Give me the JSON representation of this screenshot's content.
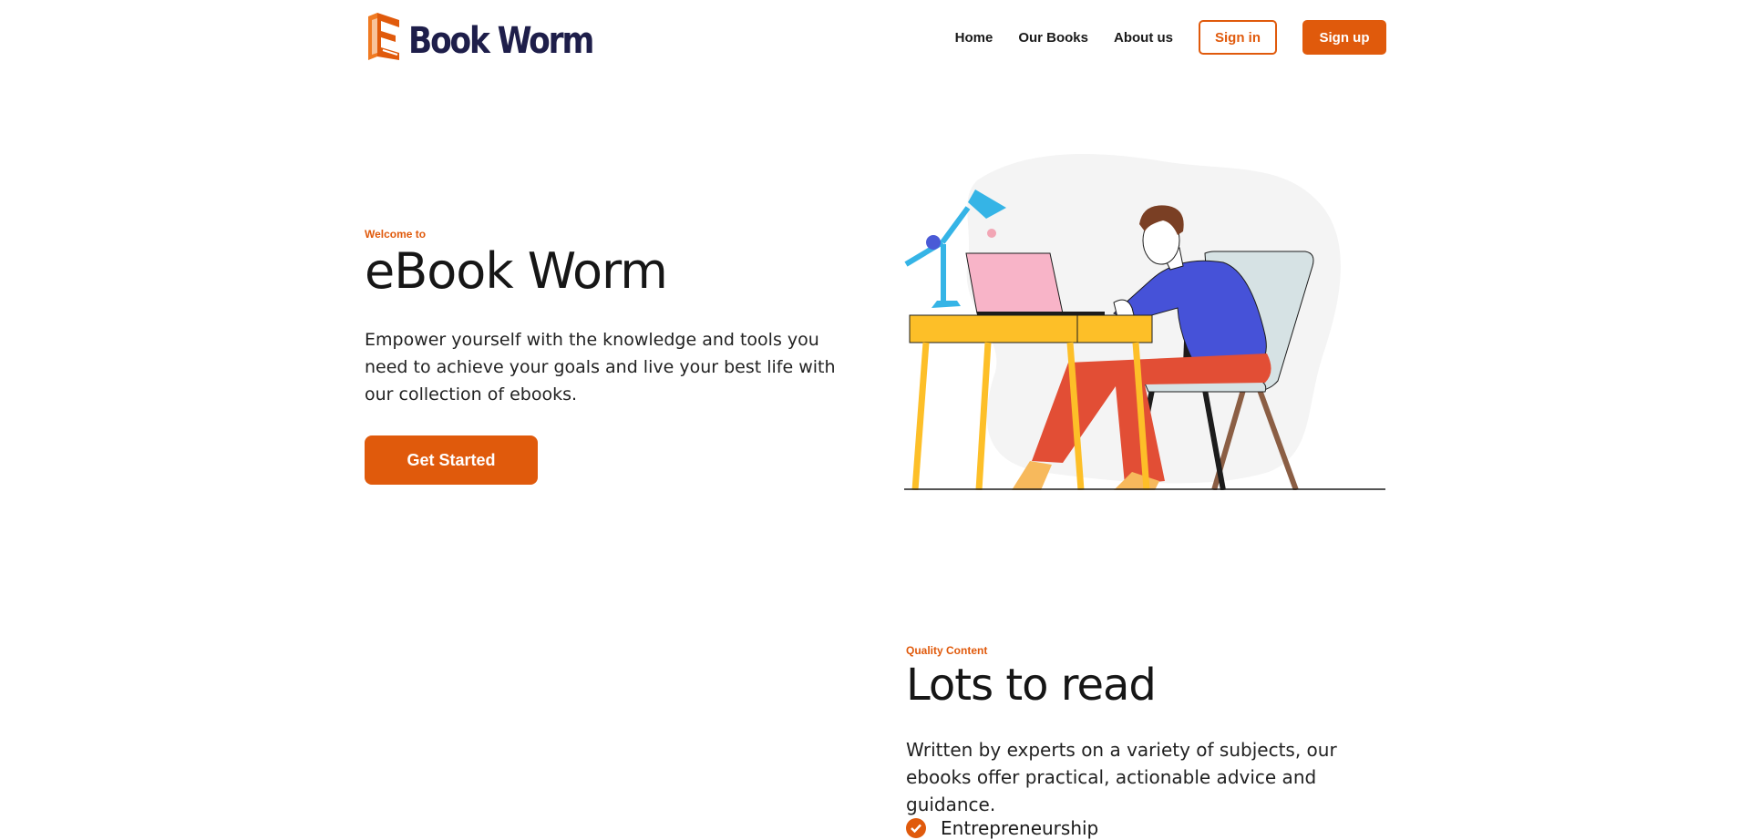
{
  "header": {
    "logo_text": "Book Worm",
    "nav": [
      "Home",
      "Our Books",
      "About us"
    ],
    "sign_in": "Sign in",
    "sign_up": "Sign up"
  },
  "hero": {
    "eyebrow": "Welcome to",
    "title": "eBook Worm",
    "description": "Empower yourself with the knowledge and tools you need to achieve your goals and live your best life with our collection of ebooks.",
    "cta": "Get Started"
  },
  "features": {
    "eyebrow": "Quality Content",
    "title": "Lots to read",
    "description": "Written by experts on a variety of subjects, our ebooks offer practical, actionable advice and guidance.",
    "items": [
      "Entrepreneurship"
    ]
  },
  "colors": {
    "accent": "#e05a0c",
    "logo_dark": "#1e1e4a",
    "text": "#161616"
  },
  "icons": [
    "book-logo-icon",
    "check-circle-icon"
  ]
}
